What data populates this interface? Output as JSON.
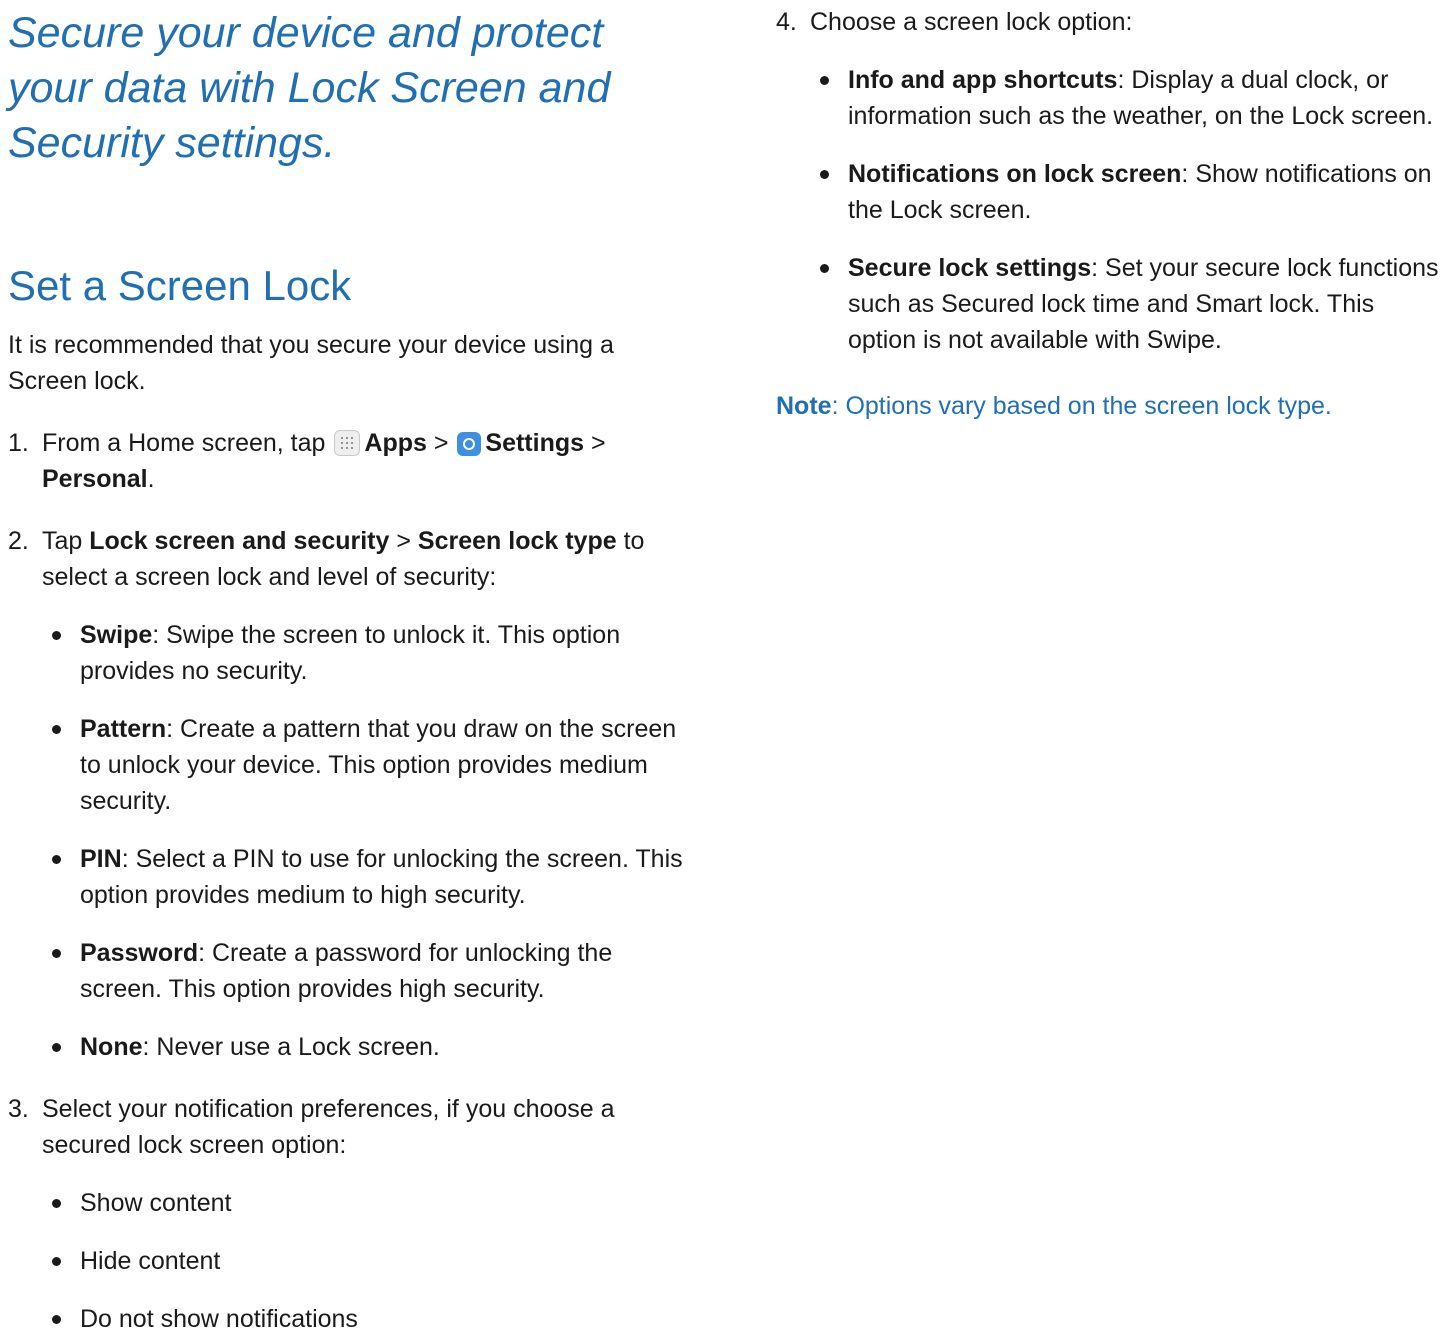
{
  "intro": "Secure your device and protect your data with Lock Screen and Security settings.",
  "section_title": "Set a Screen Lock",
  "lead": "It is recommended that you secure your device using a Screen lock.",
  "step1": {
    "num": "1.",
    "t1": "From a Home screen, tap",
    "apps_icon": "apps-grid-icon",
    "apps": "Apps",
    "sep1": ">",
    "settings_icon": "settings-gear-icon",
    "settings": "Settings",
    "sep2": ">",
    "personal": "Personal",
    "end": "."
  },
  "step2": {
    "num": "2.",
    "t1": "Tap",
    "b1": "Lock screen and security",
    "sep": ">",
    "b2": "Screen lock type",
    "t2": "to select a screen lock and level of security:",
    "items": [
      {
        "term": "Swipe",
        "desc": ": Swipe the screen to unlock it. This option provides no security."
      },
      {
        "term": "Pattern",
        "desc": ": Create a pattern that you draw on the screen to unlock your device. This option provides medium security."
      },
      {
        "term": "PIN",
        "desc": ": Select a PIN to use for unlocking the screen. This option provides medium to high security."
      },
      {
        "term": "Password",
        "desc": ": Create a password for unlocking the screen. This option provides high security."
      },
      {
        "term": "None",
        "desc": ": Never use a Lock screen."
      }
    ]
  },
  "step3": {
    "num": "3.",
    "text": "Select your notification preferences, if you choose a secured lock screen option:",
    "items": [
      "Show content",
      "Hide content",
      "Do not show notifications"
    ]
  },
  "step4": {
    "num": "4.",
    "text": "Choose a screen lock option:",
    "items": [
      {
        "term": "Info and app shortcuts",
        "desc": ": Display a dual clock, or information such as the weather, on the Lock screen."
      },
      {
        "term": "Notifications on lock screen",
        "desc": ": Show notifications on the Lock screen."
      },
      {
        "term": "Secure lock settings",
        "desc": ": Set your secure lock functions such as Secured lock time and Smart lock. This option is not available with Swipe."
      }
    ]
  },
  "note": {
    "label": "Note",
    "text": ": Options vary based on the screen lock type."
  }
}
